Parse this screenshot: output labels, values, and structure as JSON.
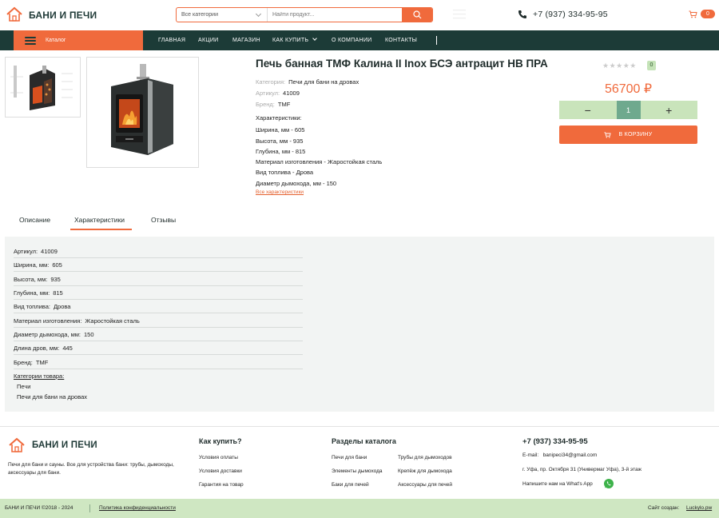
{
  "header": {
    "brand": "БАНИ И ПЕЧИ",
    "search": {
      "category": "Все категории",
      "placeholder": "Найти продукт..."
    },
    "phone": "+7 (937) 334-95-95",
    "cart_count": "0"
  },
  "nav": {
    "catalog_label": "Каталог",
    "items": [
      "ГЛАВНАЯ",
      "АКЦИИ",
      "МАГАЗИН",
      "КАК КУПИТЬ",
      "О КОМПАНИИ",
      "КОНТАКТЫ"
    ]
  },
  "product": {
    "title": "Печь банная ТМФ Калина II Inox БСЭ антрацит НВ ПРА",
    "category_label": "Категория:",
    "category_value": "Печи для бани на дровах",
    "article_label": "Артикул:",
    "article_value": "41009",
    "brand_label": "Бренд:",
    "brand_value": "TMF",
    "specs_title": "Характеристики:",
    "specs": [
      {
        "k": "Ширина, мм -",
        "v": "605"
      },
      {
        "k": "Высота, мм -",
        "v": "935"
      },
      {
        "k": "Глубина, мм -",
        "v": "815"
      },
      {
        "k": "Материал изготовления -",
        "v": "Жаростойкая сталь"
      },
      {
        "k": "Вид топлива -",
        "v": "Дрова"
      },
      {
        "k": "Диаметр дымохода, мм -",
        "v": "150"
      }
    ],
    "all_specs_link": "Все характеристики",
    "rating_count": "0",
    "rating_value": 0,
    "price": "56700 ₽",
    "qty_minus": "−",
    "qty_value": "1",
    "qty_plus": "+",
    "cart_button": "В КОРЗИНУ"
  },
  "tabs": [
    "Описание",
    "Характеристики",
    "Отзывы"
  ],
  "spec_table": {
    "rows": [
      {
        "k": "Артикул:",
        "v": "41009"
      },
      {
        "k": "Ширина, мм:",
        "v": "605"
      },
      {
        "k": "Высота, мм:",
        "v": "935"
      },
      {
        "k": "Глубина, мм:",
        "v": "815"
      },
      {
        "k": "Вид топлива:",
        "v": "Дрова"
      },
      {
        "k": "Материал изготовления:",
        "v": "Жаростойкая сталь"
      },
      {
        "k": "Диаметр дымохода, мм:",
        "v": "150"
      },
      {
        "k": "Длина дров, мм:",
        "v": "445"
      },
      {
        "k": "Бренд:",
        "v": "TMF"
      }
    ],
    "categories_title": "Категории товара:",
    "categories": [
      "Печи",
      "Печи для бани на дровах"
    ]
  },
  "footer": {
    "brand": "БАНИ И ПЕЧИ",
    "about": "Печи для бани и сауны. Все для устройства бани: трубы, дымоходы, аксессуары для бани.",
    "how_to_buy_title": "Как купить?",
    "how_to_buy": [
      "Условия оплаты",
      "Условия доставки",
      "Гарантия на товар"
    ],
    "sections_title": "Разделы каталога",
    "sections_col1": [
      "Печи для бани",
      "Элементы дымохода",
      "Баки для печей"
    ],
    "sections_col2": [
      "Трубы для дымоходов",
      "Крепёж для дымохода",
      "Аксессуары для печей"
    ],
    "phone": "+7 (937) 334-95-95",
    "email_label": "E-mail:",
    "email": "banipeci34@gmail.com",
    "address": "г. Уфа, пр. Октября 31 (Универмаг Уфа), 3-й этаж",
    "whatsapp": "Напишите нам на What's App",
    "copyright": "БАНИ И ПЕЧИ ©2018 - 2024",
    "privacy": "Политика конфиденциальности",
    "made_by_label": "Сайт создан:",
    "made_by": "Luckylo.pw"
  },
  "colors": {
    "accent": "#f06a3c",
    "dark": "#1c3b37",
    "light_green": "#cfe7c2"
  }
}
